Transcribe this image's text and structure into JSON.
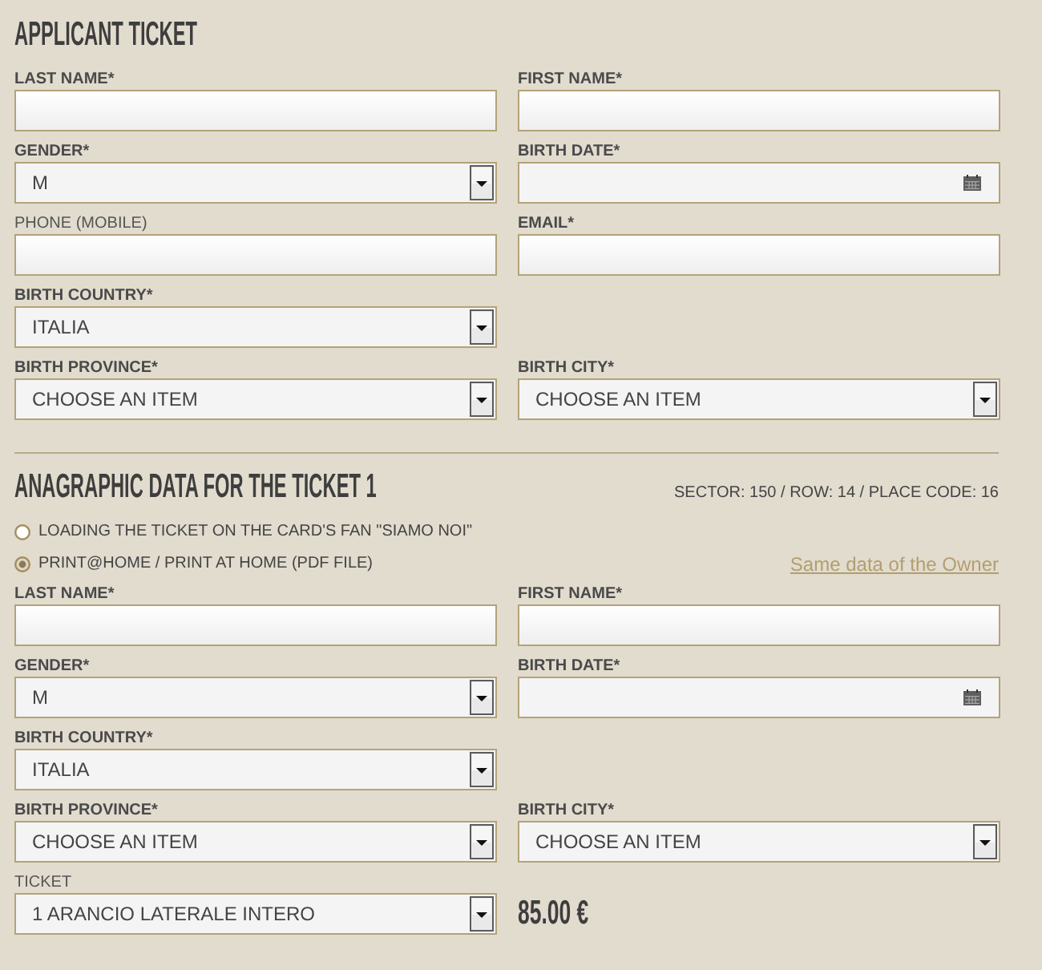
{
  "sections": [
    {
      "title": "APPLICANT TICKET",
      "rows": [
        [
          {
            "kind": "text",
            "label": "LAST NAME*",
            "required": true
          },
          {
            "kind": "text",
            "label": "FIRST NAME*",
            "required": true
          }
        ],
        [
          {
            "kind": "select",
            "label": "GENDER*",
            "required": true,
            "value": "M"
          },
          {
            "kind": "date",
            "label": "BIRTH DATE*",
            "required": true
          }
        ],
        [
          {
            "kind": "text",
            "label": "PHONE (MOBILE)",
            "required": false
          },
          {
            "kind": "text",
            "label": "EMAIL*",
            "required": true
          }
        ],
        [
          {
            "kind": "select",
            "label": "BIRTH COUNTRY*",
            "required": true,
            "value": "ITALIA"
          }
        ],
        [
          {
            "kind": "select",
            "label": "BIRTH PROVINCE*",
            "required": true,
            "value": "CHOOSE AN ITEM"
          },
          {
            "kind": "select",
            "label": "BIRTH CITY*",
            "required": true,
            "value": "CHOOSE AN ITEM"
          }
        ]
      ]
    },
    {
      "title": "ANAGRAPHIC DATA FOR THE TICKET 1",
      "seat_info": "SECTOR: 150 / ROW: 14 / PLACE CODE: 16",
      "delivery_options": [
        {
          "label": "LOADING THE TICKET ON THE CARD'S FAN \"SIAMO NOI\"",
          "selected": false
        },
        {
          "label": "PRINT@HOME / PRINT AT HOME (PDF FILE)",
          "selected": true
        }
      ],
      "owner_link": "Same data of the Owner",
      "rows": [
        [
          {
            "kind": "text",
            "label": "LAST NAME*",
            "required": true
          },
          {
            "kind": "text",
            "label": "FIRST NAME*",
            "required": true
          }
        ],
        [
          {
            "kind": "select",
            "label": "GENDER*",
            "required": true,
            "value": "M"
          },
          {
            "kind": "date",
            "label": "BIRTH DATE*",
            "required": true
          }
        ],
        [
          {
            "kind": "select",
            "label": "BIRTH COUNTRY*",
            "required": true,
            "value": "ITALIA"
          }
        ],
        [
          {
            "kind": "select",
            "label": "BIRTH PROVINCE*",
            "required": true,
            "value": "CHOOSE AN ITEM"
          },
          {
            "kind": "select",
            "label": "BIRTH CITY*",
            "required": true,
            "value": "CHOOSE AN ITEM"
          }
        ],
        [
          {
            "kind": "select",
            "label": "TICKET",
            "required": false,
            "value": "1 ARANCIO LATERALE INTERO"
          },
          {
            "kind": "price",
            "value": "85.00 €"
          }
        ]
      ]
    }
  ]
}
